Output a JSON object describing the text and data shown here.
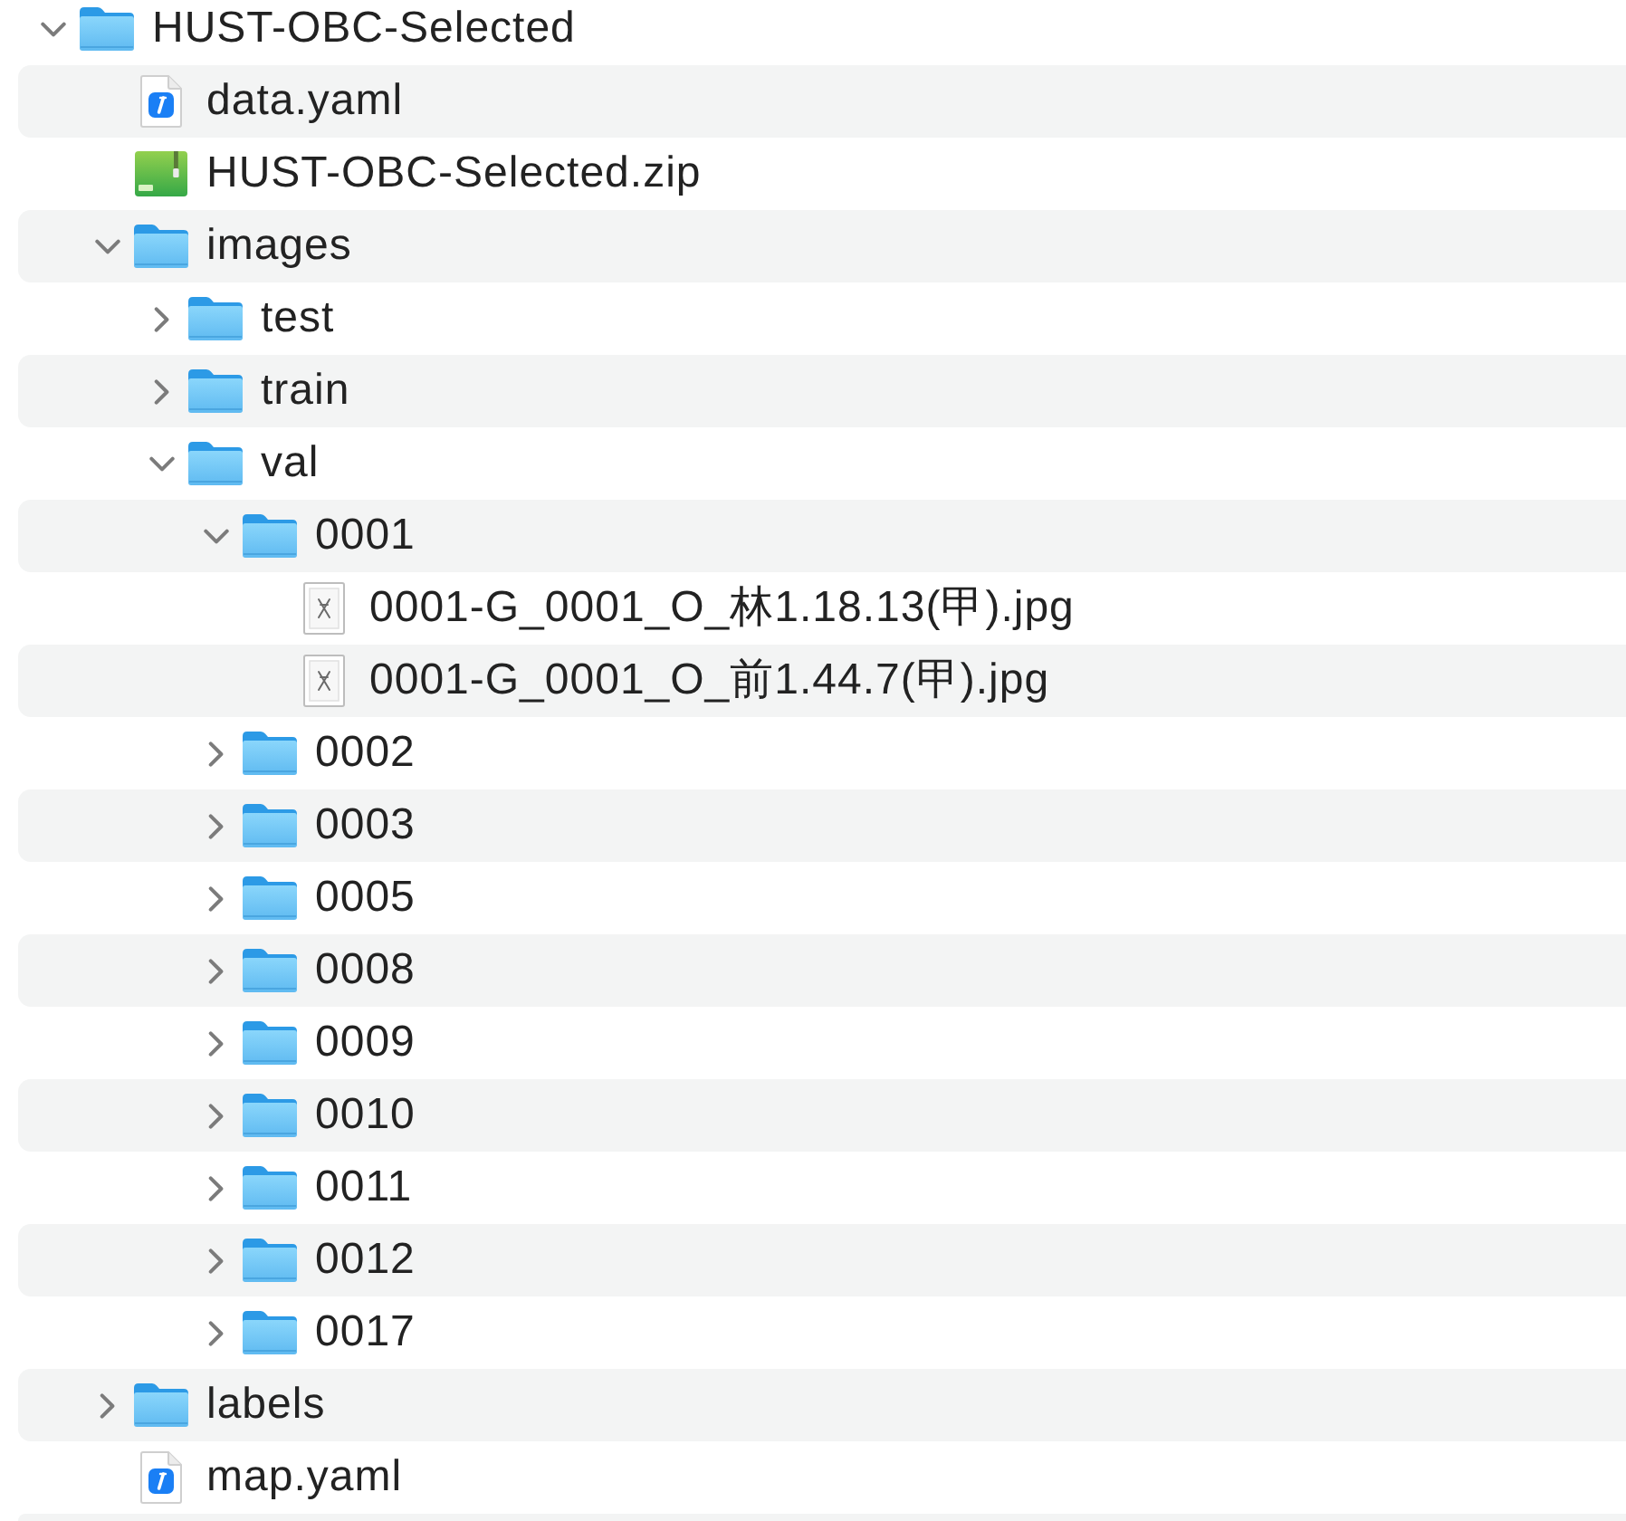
{
  "tree": [
    {
      "name": "HUST-OBC-Selected",
      "kind": "folder",
      "expanded": true,
      "children": [
        {
          "name": "data.yaml",
          "kind": "yaml"
        },
        {
          "name": "HUST-OBC-Selected.zip",
          "kind": "zip"
        },
        {
          "name": "images",
          "kind": "folder",
          "expanded": true,
          "children": [
            {
              "name": "test",
              "kind": "folder",
              "expanded": false
            },
            {
              "name": "train",
              "kind": "folder",
              "expanded": false
            },
            {
              "name": "val",
              "kind": "folder",
              "expanded": true,
              "children": [
                {
                  "name": "0001",
                  "kind": "folder",
                  "expanded": true,
                  "children": [
                    {
                      "name": "0001-G_0001_O_林1.18.13(甲).jpg",
                      "kind": "image"
                    },
                    {
                      "name": "0001-G_0001_O_前1.44.7(甲).jpg",
                      "kind": "image"
                    }
                  ]
                },
                {
                  "name": "0002",
                  "kind": "folder",
                  "expanded": false
                },
                {
                  "name": "0003",
                  "kind": "folder",
                  "expanded": false
                },
                {
                  "name": "0005",
                  "kind": "folder",
                  "expanded": false
                },
                {
                  "name": "0008",
                  "kind": "folder",
                  "expanded": false
                },
                {
                  "name": "0009",
                  "kind": "folder",
                  "expanded": false
                },
                {
                  "name": "0010",
                  "kind": "folder",
                  "expanded": false
                },
                {
                  "name": "0011",
                  "kind": "folder",
                  "expanded": false
                },
                {
                  "name": "0012",
                  "kind": "folder",
                  "expanded": false
                },
                {
                  "name": "0017",
                  "kind": "folder",
                  "expanded": false
                }
              ]
            }
          ]
        },
        {
          "name": "labels",
          "kind": "folder",
          "expanded": false
        },
        {
          "name": "map.yaml",
          "kind": "yaml"
        }
      ]
    }
  ]
}
